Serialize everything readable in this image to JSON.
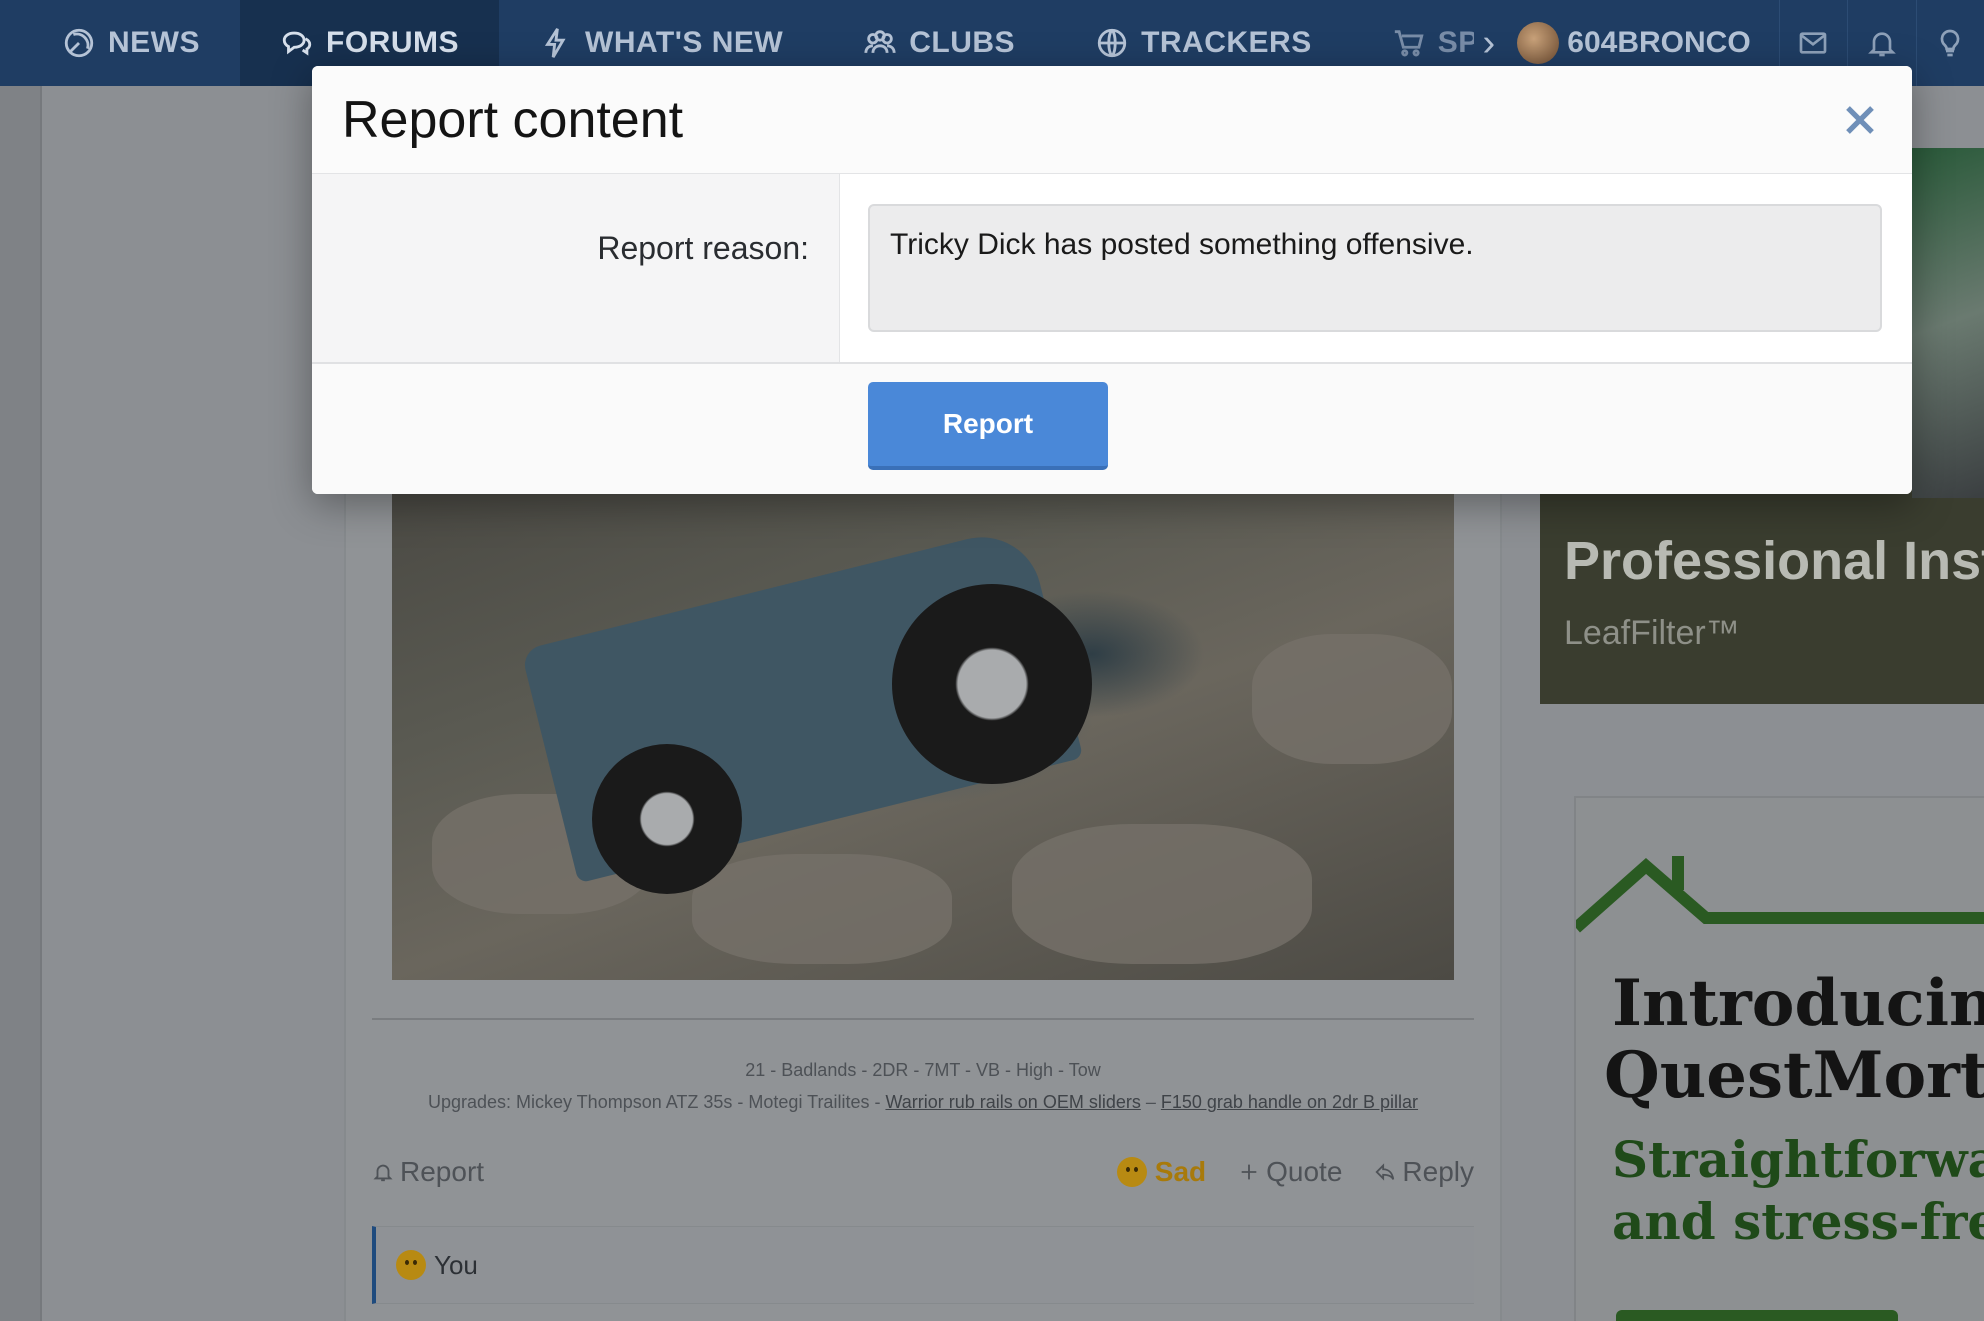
{
  "nav": {
    "tabs": [
      {
        "label": "NEWS",
        "icon": "radar-icon"
      },
      {
        "label": "FORUMS",
        "icon": "chat-bubbles-icon"
      },
      {
        "label": "WHAT'S NEW",
        "icon": "lightning-icon"
      },
      {
        "label": "CLUBS",
        "icon": "users-group-icon"
      },
      {
        "label": "TRACKERS",
        "icon": "globe-icon"
      },
      {
        "label": "SPONS",
        "icon": "cart-icon"
      }
    ],
    "username": "604BRONCO",
    "colors": {
      "bar": "#1f3d63",
      "active": "#17304f"
    }
  },
  "modal": {
    "title": "Report content",
    "reason_label": "Report reason:",
    "reason_value": "Tricky Dick has posted something offensive.",
    "submit_label": "Report",
    "colors": {
      "button": "#4a88d8",
      "close_icon": "#6f8fb8"
    }
  },
  "post": {
    "signature_line1": "21 - Badlands - 2DR - 7MT - VB - High - Tow",
    "signature_prefix": "Upgrades: Mickey Thompson ATZ 35s - Motegi Trailites - ",
    "signature_link1": "Warrior rub rails on OEM sliders",
    "signature_sep": " – ",
    "signature_link2": "F150 grab handle on 2dr B pillar",
    "actions": {
      "report": "Report",
      "reaction": "Sad",
      "quote": "Quote",
      "reply": "Reply"
    },
    "reactions_summary": "You"
  },
  "ads": {
    "ad1_title": "Professional Inst",
    "ad1_brand": "LeafFilter™",
    "ad2_line1": "Introducing",
    "ad2_line2": "QuestMortg",
    "ad2_line3": "Straightforwar",
    "ad2_line4": "and stress-free"
  }
}
